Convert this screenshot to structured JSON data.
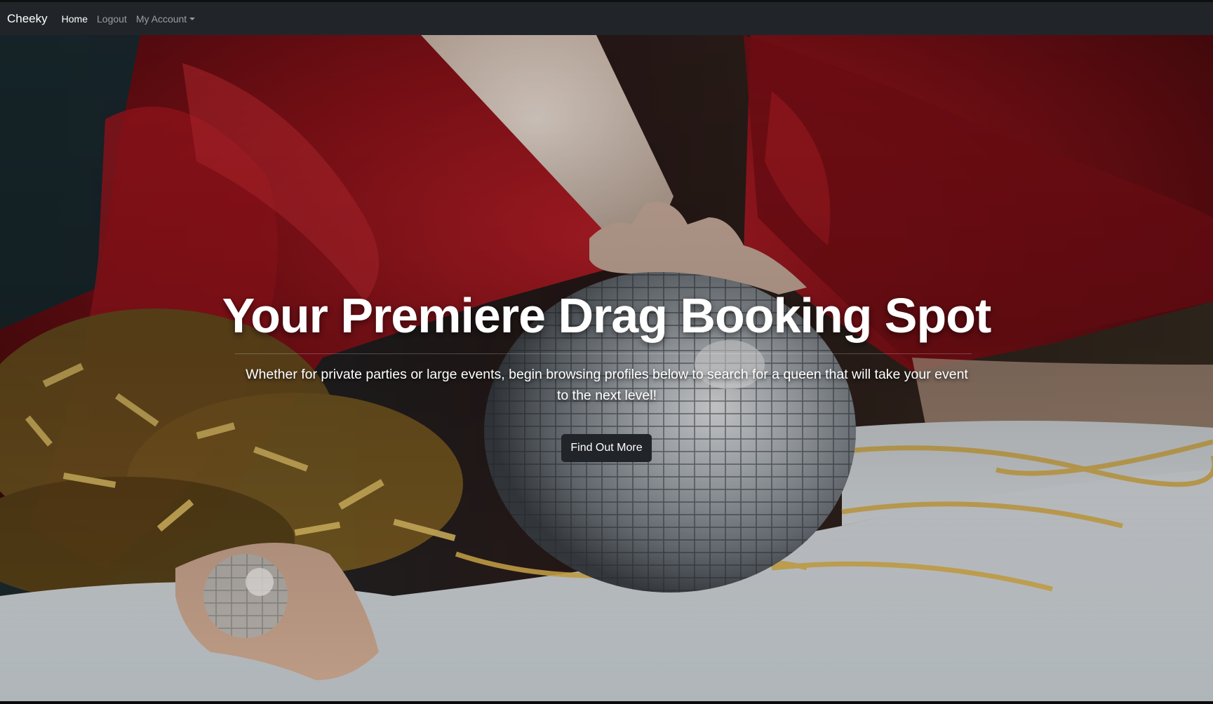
{
  "navbar": {
    "brand": "Cheeky",
    "links": [
      {
        "label": "Home",
        "active": true
      },
      {
        "label": "Logout",
        "active": false
      },
      {
        "label": "My Account",
        "active": false
      }
    ]
  },
  "hero": {
    "headline": "Your Premiere Drag Booking Spot",
    "subtext": "Whether for private parties or large events, begin browsing profiles below to search for a queen that will take your event to the next level!",
    "cta_label": "Find Out More",
    "image_icon": "disco-ball-photo"
  },
  "colors": {
    "navbar_bg": "#212529",
    "button_bg": "#212529",
    "text": "#ffffff",
    "nav_inactive": "rgba(255,255,255,0.55)"
  }
}
